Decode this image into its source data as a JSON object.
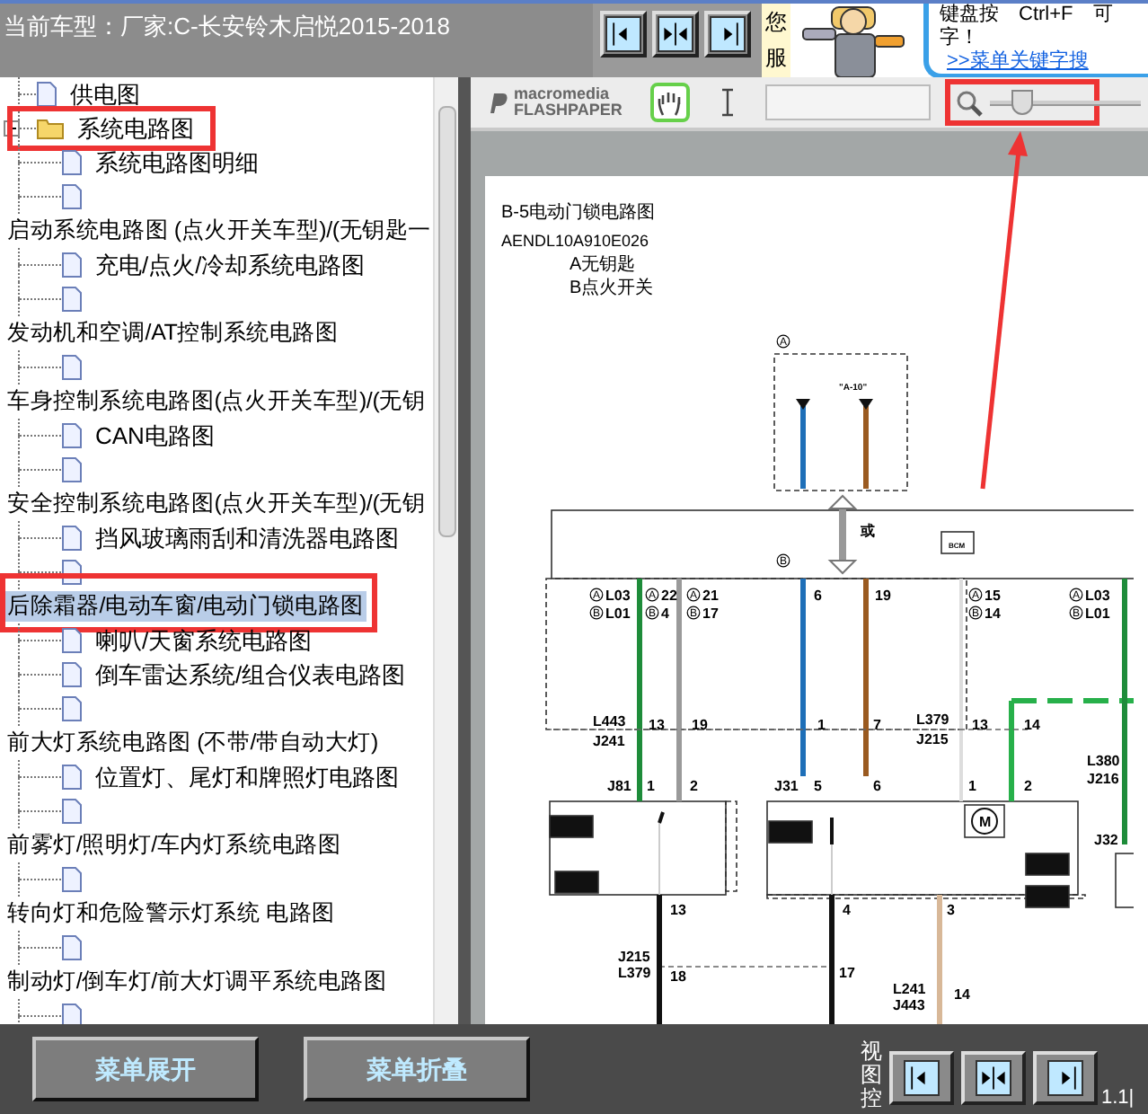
{
  "header": {
    "model_label": "当前车型：厂家:C-长安铃木启悦2015-2018",
    "service_text": "您服",
    "tip_lines": [
      "键盘按　Ctrl+F　可",
      "字！"
    ],
    "tip_link": ">>菜单关键字搜"
  },
  "tree": [
    {
      "kind": "file",
      "label": "供电图",
      "selected": false,
      "annotated": false
    },
    {
      "kind": "folder",
      "label": "系统电路图",
      "selected": false,
      "annotated": true,
      "expanded": true,
      "children": [
        {
          "kind": "file",
          "label": "系统电路图明细",
          "selected": false
        },
        {
          "kind": "file",
          "selected": false
        }
      ]
    },
    {
      "kind": "heading",
      "label": "启动系统电路图 (点火开关车型)/(无钥匙一",
      "selected": false,
      "annotated": false,
      "children": [
        {
          "kind": "file",
          "label": "充电/点火/冷却系统电路图",
          "selected": false
        },
        {
          "kind": "file",
          "selected": false
        }
      ]
    },
    {
      "kind": "heading",
      "label": "发动机和空调/AT控制系统电路图",
      "selected": false,
      "annotated": false,
      "children": [
        {
          "kind": "file",
          "selected": false
        }
      ]
    },
    {
      "kind": "heading",
      "label": "车身控制系统电路图(点火开关车型)/(无钥",
      "selected": false,
      "annotated": false,
      "children": [
        {
          "kind": "file",
          "label": "CAN电路图",
          "selected": false
        },
        {
          "kind": "file",
          "selected": false
        }
      ]
    },
    {
      "kind": "heading",
      "label": "安全控制系统电路图(点火开关车型)/(无钥",
      "selected": false,
      "annotated": false,
      "children": [
        {
          "kind": "file",
          "label": "挡风玻璃雨刮和清洗器电路图",
          "selected": false
        },
        {
          "kind": "file",
          "selected": false
        }
      ]
    },
    {
      "kind": "heading",
      "label": "后除霜器/电动车窗/电动门锁电路图",
      "selected": true,
      "annotated": true,
      "children": [
        {
          "kind": "file",
          "label": "喇叭/天窗系统电路图",
          "selected": false
        },
        {
          "kind": "file",
          "label": "倒车雷达系统/组合仪表电路图",
          "selected": false
        },
        {
          "kind": "file",
          "selected": false
        }
      ]
    },
    {
      "kind": "heading",
      "label": "前大灯系统电路图 (不带/带自动大灯)",
      "selected": false,
      "annotated": false,
      "children": [
        {
          "kind": "file",
          "label": "位置灯、尾灯和牌照灯电路图",
          "selected": false
        },
        {
          "kind": "file",
          "selected": false
        }
      ]
    },
    {
      "kind": "heading",
      "label": "前雾灯/照明灯/车内灯系统电路图",
      "selected": false,
      "annotated": false,
      "children": [
        {
          "kind": "file",
          "selected": false
        }
      ]
    },
    {
      "kind": "heading",
      "label": "转向灯和危险警示灯系统 电路图",
      "selected": false,
      "annotated": false,
      "children": [
        {
          "kind": "file",
          "selected": false
        }
      ]
    },
    {
      "kind": "heading",
      "label": "制动灯/倒车灯/前大灯调平系统电路图",
      "selected": false,
      "annotated": false,
      "children": [
        {
          "kind": "file",
          "selected": false
        }
      ]
    }
  ],
  "viewer": {
    "logo_lines": [
      "macromedia",
      "FLASHPAPER"
    ],
    "tools": [
      {
        "kind": "hand",
        "selected": true
      },
      {
        "kind": "text",
        "selected": false
      }
    ],
    "zoom": {
      "level": 0.21,
      "annotated": true
    },
    "document": {
      "title_lines": [
        "B-5电动门锁电路图",
        "AENDL10A910E026",
        "A无钥匙",
        "B点火开关"
      ],
      "labels": [
        {
          "tag": "A"
        },
        {
          "tag": "B"
        },
        {
          "text": "或"
        },
        {
          "text": "BCM"
        },
        {
          "tag": "A",
          "text": "L03"
        },
        {
          "tag": "B",
          "text": "L01"
        },
        {
          "tag": "A",
          "text": "22"
        },
        {
          "tag": "B",
          "text": "4"
        },
        {
          "tag": "A",
          "text": "21"
        },
        {
          "tag": "B",
          "text": "17"
        },
        {
          "text": "6"
        },
        {
          "text": "19"
        },
        {
          "tag": "A",
          "text": "15"
        },
        {
          "tag": "B",
          "text": "14"
        },
        {
          "tag": "A",
          "text": "L03"
        },
        {
          "tag": "B",
          "text": "L01"
        },
        {
          "text": "L443"
        },
        {
          "text": "J241"
        },
        {
          "text": "13"
        },
        {
          "text": "19"
        },
        {
          "text": "1"
        },
        {
          "text": "7"
        },
        {
          "text": "L379"
        },
        {
          "text": "J215"
        },
        {
          "text": "13"
        },
        {
          "text": "14"
        },
        {
          "text": "L380"
        },
        {
          "text": "J216"
        },
        {
          "text": "J81"
        },
        {
          "text": "1"
        },
        {
          "text": "2"
        },
        {
          "text": "J31"
        },
        {
          "text": "5"
        },
        {
          "text": "6"
        },
        {
          "text": "1"
        },
        {
          "text": "2"
        },
        {
          "text": "J32"
        },
        {
          "text": "M"
        },
        {
          "text": "13"
        },
        {
          "text": "4"
        },
        {
          "text": "3"
        },
        {
          "text": "J215"
        },
        {
          "text": "L379"
        },
        {
          "text": "18"
        },
        {
          "text": "17"
        },
        {
          "text": "L241"
        },
        {
          "text": "J443"
        },
        {
          "text": "14"
        },
        {
          "text": "\"A-10\""
        }
      ]
    }
  },
  "bottom": {
    "buttons": [
      "菜单展开",
      "菜单折叠"
    ],
    "view_label": "视图控",
    "page": "1.1|"
  }
}
